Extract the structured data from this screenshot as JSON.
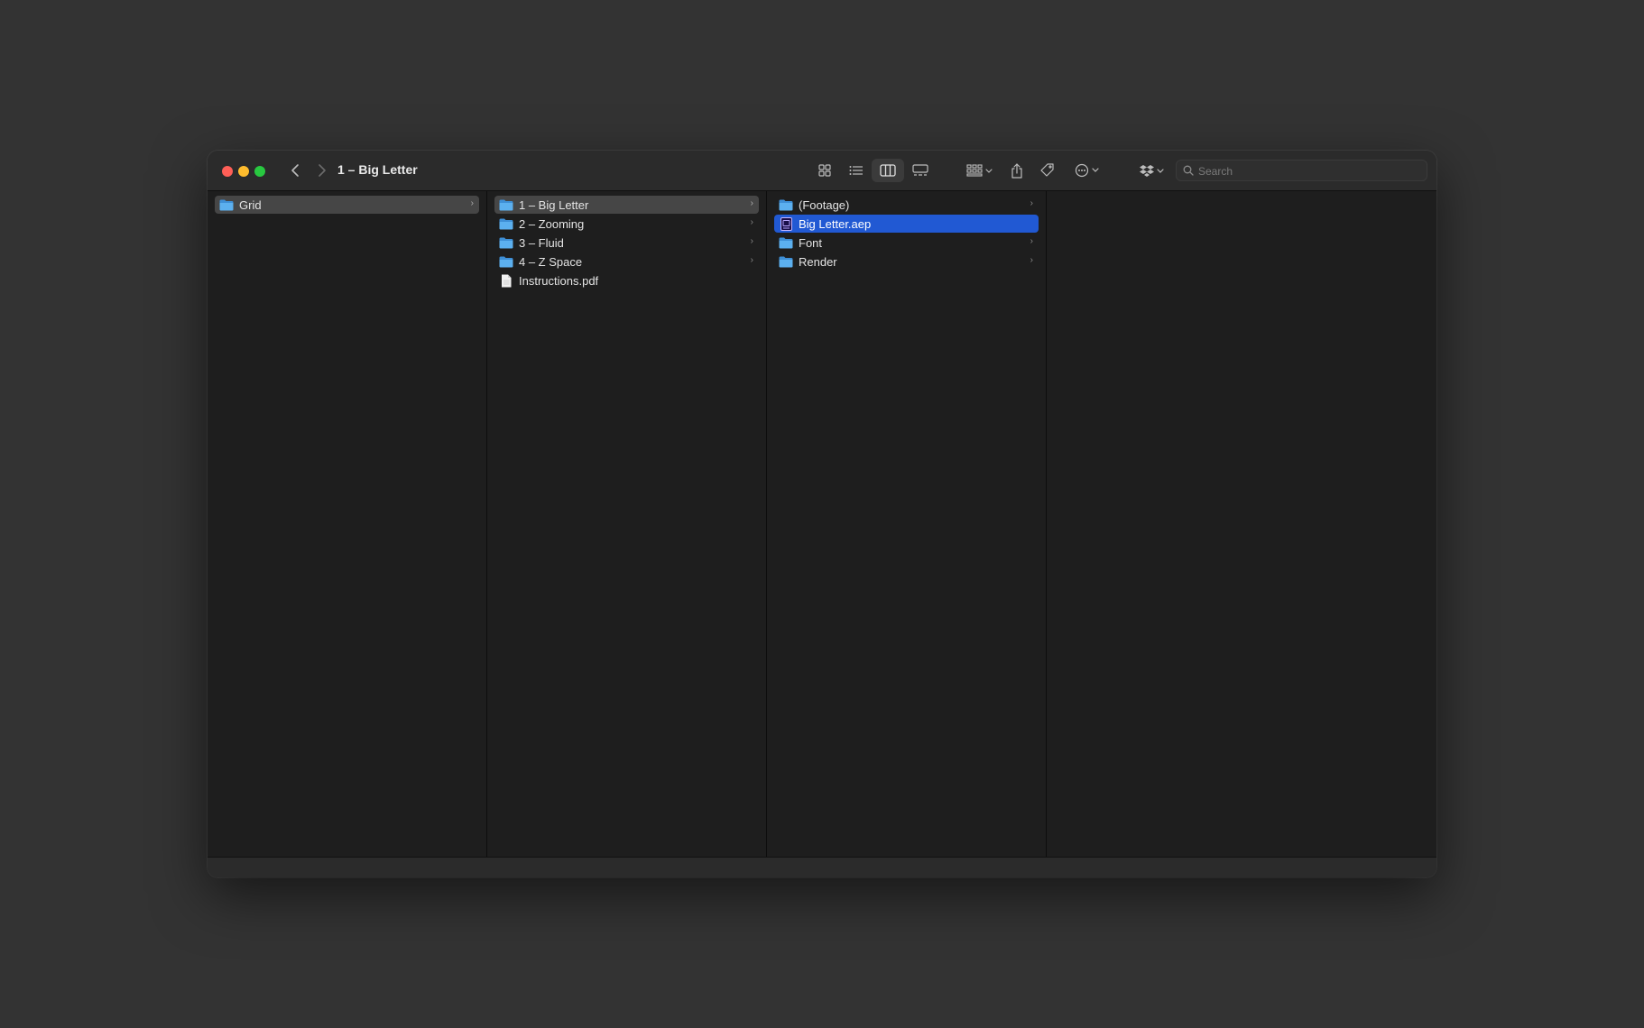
{
  "window": {
    "title": "1 – Big Letter"
  },
  "toolbar": {
    "buttons": [
      "icon-view-icon",
      "list-view-icon",
      "column-view-icon",
      "gallery-view-icon",
      "group-icon",
      "share-icon",
      "tag-icon",
      "more-icon",
      "dropbox-icon"
    ],
    "search_placeholder": "Search"
  },
  "columns": {
    "col1": [
      {
        "name": "Grid",
        "type": "folder",
        "state": "selected-gray"
      }
    ],
    "col2": [
      {
        "name": "1 – Big Letter",
        "type": "folder",
        "state": "selected-gray"
      },
      {
        "name": "2 – Zooming",
        "type": "folder"
      },
      {
        "name": "3 – Fluid",
        "type": "folder"
      },
      {
        "name": "4 – Z Space",
        "type": "folder"
      },
      {
        "name": "Instructions.pdf",
        "type": "file"
      }
    ],
    "col3": [
      {
        "name": "(Footage)",
        "type": "folder"
      },
      {
        "name": "Big Letter.aep",
        "type": "aep",
        "state": "selected-blue"
      },
      {
        "name": "Font",
        "type": "folder"
      },
      {
        "name": "Render",
        "type": "folder"
      }
    ]
  },
  "colors": {
    "selection_blue": "#2159d3",
    "selection_gray": "#464646",
    "folder_blue": "#4aa3e8"
  }
}
